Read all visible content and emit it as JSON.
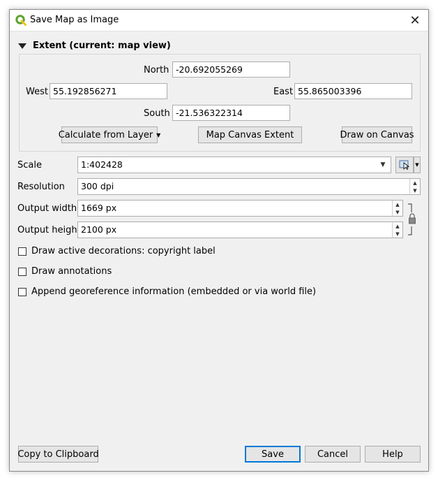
{
  "window": {
    "title": "Save Map as Image",
    "icon": "qgis-logo-icon"
  },
  "extent": {
    "header": "Extent (current: map view)",
    "north_label": "North",
    "north_value": "-20.692055269",
    "west_label": "West",
    "west_value": "55.192856271",
    "east_label": "East",
    "east_value": "55.865003396",
    "south_label": "South",
    "south_value": "-21.536322314",
    "calc_button": "Calculate from Layer",
    "canvas_button": "Map Canvas Extent",
    "draw_button": "Draw on Canvas"
  },
  "scale": {
    "label": "Scale",
    "value": "1:402428"
  },
  "resolution": {
    "label": "Resolution",
    "value": "300 dpi"
  },
  "output_width": {
    "label": "Output width",
    "value": "1669 px"
  },
  "output_height": {
    "label": "Output height",
    "value": "2100 px"
  },
  "checks": {
    "decorations": "Draw active decorations: copyright label",
    "annotations": "Draw annotations",
    "georef": "Append georeference information (embedded or via world file)"
  },
  "buttons": {
    "copy": "Copy to Clipboard",
    "save": "Save",
    "cancel": "Cancel",
    "help": "Help"
  },
  "colors": {
    "accent": "#0078d7",
    "qgis_green": "#5ba22f"
  }
}
